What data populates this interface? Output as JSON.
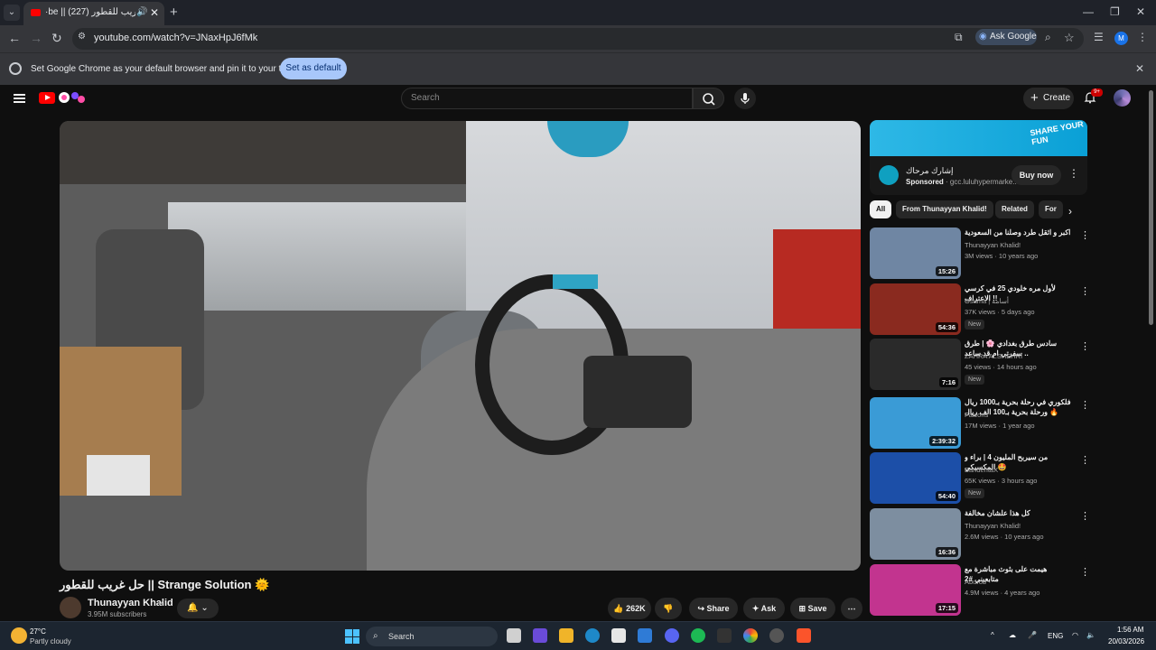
{
  "browser": {
    "tab_title": "حل عريب للقطور || (227) · YouTube",
    "tab_title_short": "·be || حل عريب للقطور (227)",
    "url": "youtube.com/watch?v=JNaxHpJ6fMk",
    "ask_google": "Ask Google",
    "profile_initial": "M",
    "infobar_message": "Set Google Chrome as your default browser and pin it to your taskbar",
    "infobar_button": "Set as default"
  },
  "youtube": {
    "search_placeholder": "Search",
    "create_label": "Create",
    "notif_count": "9+"
  },
  "video": {
    "title": "حل غريب للقطور || Strange Solution 🌞",
    "channel": "Thunayyan Khalid",
    "subscribers": "3.95M subscribers",
    "likes": "262K",
    "share": "Share",
    "ask": "Ask",
    "save": "Save"
  },
  "ad": {
    "banner": "SHARE YOUR FUN",
    "title": "إشارك مرحاك",
    "sponsored": "Sponsored",
    "domain": "gcc.luluhypermarke...",
    "button": "Buy now"
  },
  "chips": [
    "All",
    "From Thunayyan Khalid!",
    "Related",
    "For"
  ],
  "recommendations": [
    {
      "title": "اكبر و اثقل طرد وصلنا من السعودية",
      "channel": "Thunayyan Khalid!",
      "views": "3M views · 10 years ago",
      "duration": "15:26",
      "badge": "",
      "thumb": "#6f86a3"
    },
    {
      "title": "لأول مره خلودي 25 في كرسي الاعتراف !!",
      "channel": "Osama | أسامة",
      "views": "37K views · 5 days ago",
      "duration": "54:36",
      "badge": "New",
      "thumb": "#8a2a1f"
    },
    {
      "title": "سادس طرق بغدادي 🌸 | طرق سفرتي ام قد ساعد ..",
      "channel": "ZAHRA ALSHEHRI",
      "views": "45 views · 14 hours ago",
      "duration": "7:16",
      "badge": "New",
      "thumb": "#2a2a2a"
    },
    {
      "title": "فلكوري في رحلة بحرية بـ1000 ريال ورحلة بحرية بـ100 الف ريال 🔥",
      "channel": "Falcons",
      "views": "17M views · 1 year ago",
      "duration": "2:39:32",
      "badge": "",
      "thumb": "#3a9bd6"
    },
    {
      "title": "من سيربح المليون 4 | براء و المكسيكي 🤩",
      "channel": "BanderitaX",
      "views": "65K views · 3 hours ago",
      "duration": "54:40",
      "badge": "New",
      "thumb": "#1c4fa8"
    },
    {
      "title": "كل هذا علشان مخالفة",
      "channel": "Thunayyan Khalid!",
      "views": "2.6M views · 10 years ago",
      "duration": "16:36",
      "badge": "",
      "thumb": "#7d8ea0"
    },
    {
      "title": "هيمت على بثوث مباشرة مع متابعيني #2",
      "channel": "Aburob",
      "views": "4.9M views · 4 years ago",
      "duration": "17:15",
      "badge": "",
      "thumb": "#c2348f"
    }
  ],
  "taskbar": {
    "temperature": "27°C",
    "weather": "Partly cloudy",
    "search": "Search",
    "lang": "ENG",
    "time": "1:56 AM",
    "date": "20/03/2026"
  }
}
